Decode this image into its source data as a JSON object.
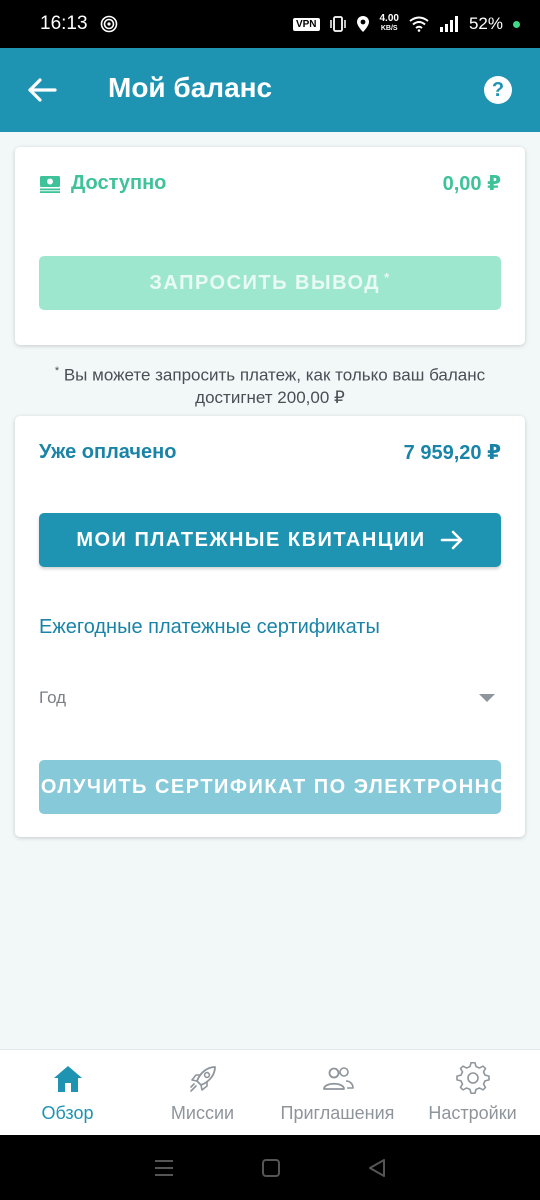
{
  "status_bar": {
    "time": "16:13",
    "vpn": "VPN",
    "speed_value": "4.00",
    "speed_unit": "KB/S",
    "battery": "52%"
  },
  "app_bar": {
    "title": "Мой баланс"
  },
  "balance_card": {
    "label": "Доступно",
    "amount": "0,00 ₽",
    "withdraw_button": "ЗАПРОСИТЬ ВЫВОД",
    "withdraw_asterisk": "*"
  },
  "note": {
    "asterisk": "*",
    "text": " Вы можете запросить платеж, как только ваш баланс достигнет 200,00 ₽"
  },
  "paid_card": {
    "label": "Уже оплачено",
    "amount": "7 959,20 ₽",
    "receipts_button": "МОИ ПЛАТЕЖНЫЕ КВИТАНЦИИ",
    "certificates_title": "Ежегодные платежные сертификаты",
    "year_placeholder": "Год",
    "certificate_button": "ПОЛУЧИТЬ СЕРТИФИКАТ ПО ЭЛЕКТРОННОЙ ПОЧТЕ"
  },
  "bottom_nav": {
    "items": [
      {
        "label": "Обзор",
        "icon": "home-icon",
        "active": true
      },
      {
        "label": "Миссии",
        "icon": "rocket-icon",
        "active": false
      },
      {
        "label": "Приглашения",
        "icon": "users-icon",
        "active": false
      },
      {
        "label": "Настройки",
        "icon": "gear-icon",
        "active": false
      }
    ]
  },
  "colors": {
    "primary": "#1e94b2",
    "accent_green": "#3ec29a",
    "disabled_green": "#9ee7cf",
    "disabled_blue": "#86c9d8"
  }
}
